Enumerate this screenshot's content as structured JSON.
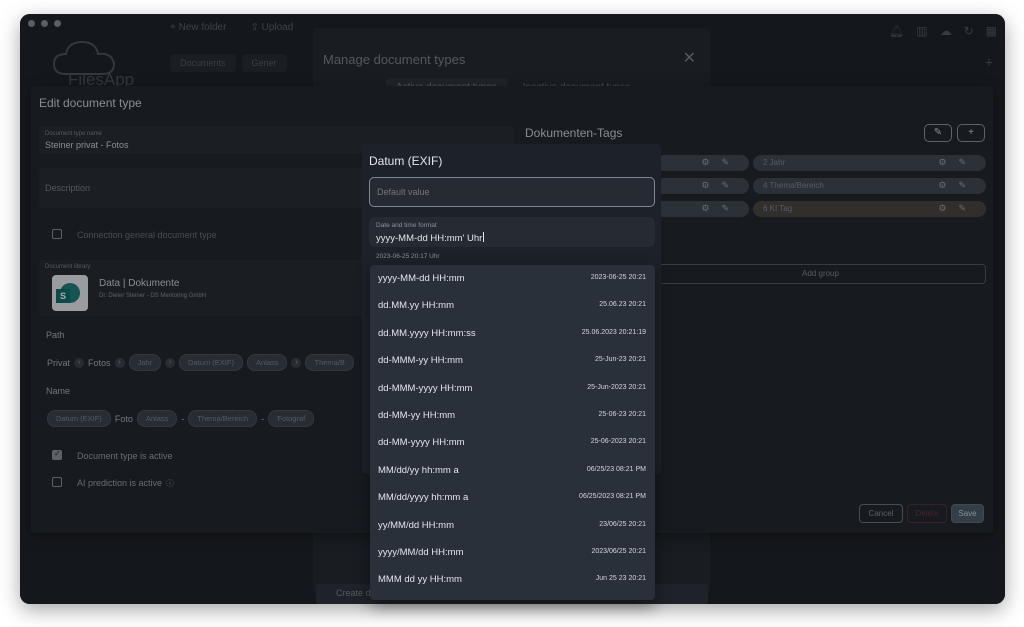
{
  "bg": {
    "app_name": "FilesApp",
    "toolbar": [
      "New folder",
      "Upload"
    ],
    "tabs": [
      "Documents",
      "Gener"
    ]
  },
  "manage": {
    "title": "Manage document types",
    "tabs": [
      "Active document types",
      "Inactive document types"
    ],
    "create": "Create d"
  },
  "edit": {
    "title": "Edit document type",
    "name_label": "Document type name",
    "name_value": "Steiner privat - Fotos",
    "description_placeholder": "Description",
    "connection_label": "Connection general document type",
    "library_label": "Document library",
    "library_name": "Data | Dokumente",
    "library_owner": "Dr. Dieter Steiner - DS Mentoring GmbH",
    "path_label": "Path",
    "path": {
      "p1": "Privat",
      "p2": "Fotos",
      "t1": "Jahr",
      "t2": "Datum (EXIF)",
      "t3": "Anlass",
      "t4": "Thema/B"
    },
    "name_label2": "Name",
    "name_parts": {
      "t1": "Datum (EXIF)",
      "s1": "Foto",
      "t2": "Anlass",
      "sep1": "-",
      "t3": "Thema/Bereich",
      "sep2": "-",
      "t4": "Fotograf"
    },
    "active_label": "Document type is active",
    "ai_label": "AI prediction is active",
    "tags_title": "Dokumenten-Tags",
    "tags": [
      "2  Jahr",
      "4  Thema/Bereich",
      "6  KI Tag"
    ],
    "add_group": "Add group",
    "cancel": "Cancel",
    "delete": "Delete",
    "save": "Save"
  },
  "datum": {
    "title": "Datum (EXIF)",
    "default_placeholder": "Default value",
    "format_label": "Date and time format",
    "format_value": "yyyy-MM-dd HH:mm' Uhr",
    "preview": "2023-06-25 20:17 Uhr",
    "options": [
      {
        "fmt": "yyyy-MM-dd HH:mm",
        "ex": "2023-06-25 20:21"
      },
      {
        "fmt": "dd.MM.yy HH:mm",
        "ex": "25.06.23 20:21"
      },
      {
        "fmt": "dd.MM.yyyy HH:mm:ss",
        "ex": "25.06.2023 20:21:19"
      },
      {
        "fmt": "dd-MMM-yy HH:mm",
        "ex": "25-Jun-23 20:21"
      },
      {
        "fmt": "dd-MMM-yyyy HH:mm",
        "ex": "25-Jun-2023 20:21"
      },
      {
        "fmt": "dd-MM-yy HH:mm",
        "ex": "25-06-23 20:21"
      },
      {
        "fmt": "dd-MM-yyyy HH:mm",
        "ex": "25-06-2023 20:21"
      },
      {
        "fmt": "MM/dd/yy hh:mm a",
        "ex": "06/25/23 08:21 PM"
      },
      {
        "fmt": "MM/dd/yyyy hh:mm a",
        "ex": "06/25/2023 08:21 PM"
      },
      {
        "fmt": "yy/MM/dd HH:mm",
        "ex": "23/06/25 20:21"
      },
      {
        "fmt": "yyyy/MM/dd HH:mm",
        "ex": "2023/06/25 20:21"
      },
      {
        "fmt": "MMM dd yy HH:mm",
        "ex": "Jun 25 23 20:21"
      }
    ]
  }
}
